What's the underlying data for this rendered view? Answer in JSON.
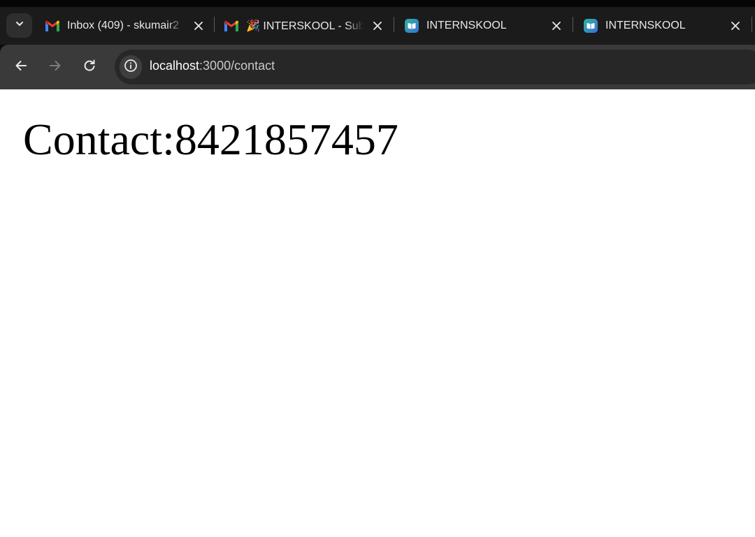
{
  "browser": {
    "tabs": [
      {
        "title": "Inbox (409) - skumair2",
        "favicon": "gmail-icon"
      },
      {
        "title": "🎉 INTERSKOOL - Sub",
        "favicon": "gmail-icon"
      },
      {
        "title": "INTERNSKOOL",
        "favicon": "internskool-icon"
      },
      {
        "title": "INTERNSKOOL",
        "favicon": "internskool-icon"
      }
    ],
    "url_host": "localhost",
    "url_path": ":3000/contact",
    "icons": {
      "tab_search": "chevron-down-icon",
      "back": "back-arrow-icon",
      "forward": "forward-arrow-icon",
      "reload": "reload-icon",
      "site_info": "info-icon",
      "tab_close": "close-icon"
    },
    "colors": {
      "tab_bar": "#1b1b1b",
      "toolbar": "#3a3a3a",
      "omnibox": "#272727"
    }
  },
  "page": {
    "heading": "Contact:8421857457"
  }
}
